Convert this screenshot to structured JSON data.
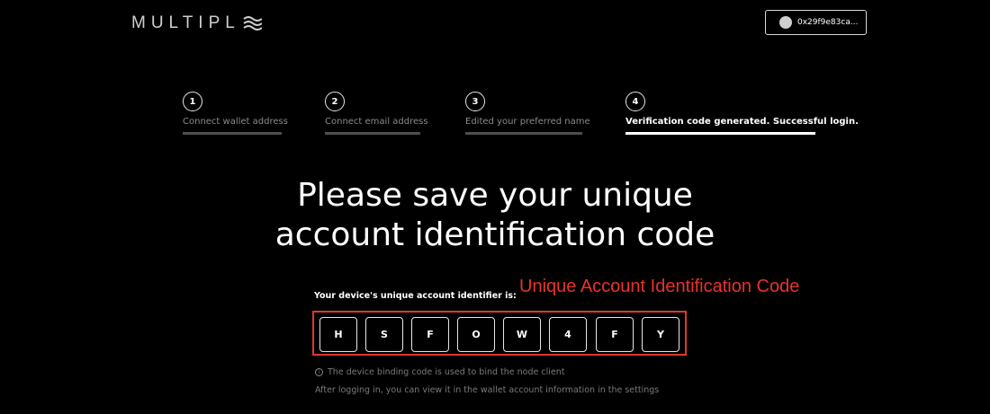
{
  "header": {
    "logo_text": "MULTIPL",
    "wallet_address": "0x29f9e83ca..."
  },
  "steps": [
    {
      "number": "1",
      "label": "Connect wallet address",
      "active": false
    },
    {
      "number": "2",
      "label": "Connect email address",
      "active": false
    },
    {
      "number": "3",
      "label": "Edited your preferred name",
      "active": false
    },
    {
      "number": "4",
      "label": "Verification code generated. Successful login.",
      "active": true
    }
  ],
  "main": {
    "title_line1": "Please save your unique",
    "title_line2": "account identification code",
    "identifier_label": "Your device's unique account identifier is:",
    "annotation": "Unique Account Identification Code",
    "code_chars": [
      "H",
      "S",
      "F",
      "O",
      "W",
      "4",
      "F",
      "Y"
    ],
    "info_line1": "The device binding code is used to bind the node client",
    "info_line2": "After logging in, you can view it in the wallet account information in the settings"
  },
  "colors": {
    "background": "#000000",
    "annotation_red": "#e8332b",
    "active_step": "#ffffff",
    "inactive_step": "#8a8a8a"
  }
}
